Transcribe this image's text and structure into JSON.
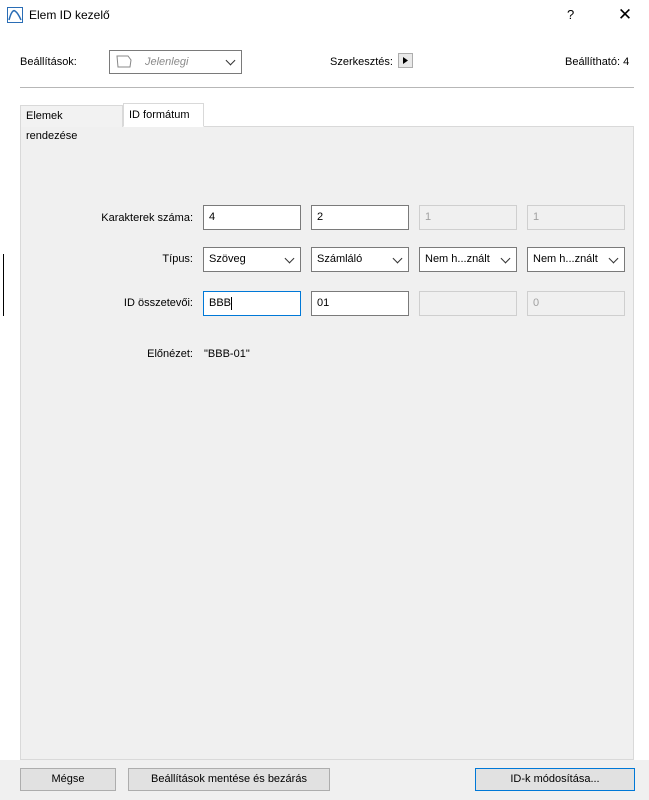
{
  "window": {
    "title": "Elem ID kezelő",
    "help": "?",
    "close": "✕"
  },
  "top": {
    "settings_label": "Beállítások:",
    "settings_value": "Jelenlegi",
    "edit_label": "Szerkesztés:",
    "count_label": "Beállítható: 4"
  },
  "tabs": [
    {
      "label": "Elemek rendezése",
      "active": false
    },
    {
      "label": "ID formátum",
      "active": true
    }
  ],
  "form": {
    "chars_label": "Karakterek száma:",
    "chars": [
      "4",
      "2",
      "1",
      "1"
    ],
    "type_label": "Típus:",
    "types": [
      "Szöveg",
      "Számláló",
      "Nem h...znált",
      "Nem h...znált"
    ],
    "parts_label": "ID összetevői:",
    "parts": [
      "BBB",
      "01",
      "",
      "0"
    ],
    "preview_label": "Előnézet:",
    "preview_value": "\"BBB-01\""
  },
  "buttons": {
    "cancel": "Mégse",
    "save_close": "Beállítások mentése és bezárás",
    "apply": "ID-k módosítása..."
  },
  "colors": {
    "focus": "#0078d7",
    "panel": "#f0f0f0"
  }
}
